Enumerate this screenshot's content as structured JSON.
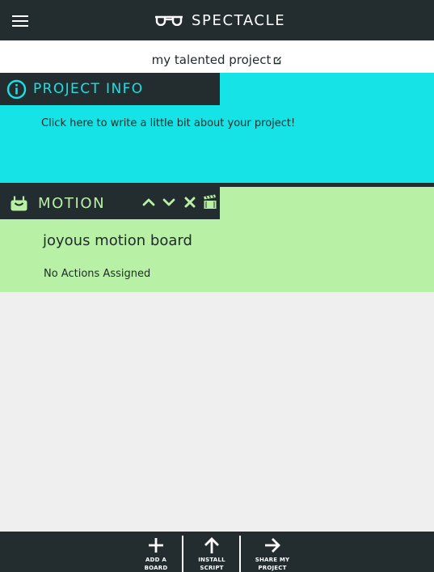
{
  "app": {
    "name": "SPECTACLE"
  },
  "header": {
    "menu_icon": "hamburger-menu-icon",
    "logo_icon": "glasses-icon"
  },
  "project": {
    "title": "my talented project",
    "edit_icon": "edit-pencil-icon"
  },
  "info_panel": {
    "tab_label": "PROJECT INFO",
    "icon": "info-circle-icon",
    "description": "Click here to write a little bit about your project!",
    "color": "#16e3e5"
  },
  "motion_panel": {
    "tab_label": "MOTION",
    "icon": "motion-board-icon",
    "board_name": "joyous motion board",
    "actions_status": "No Actions Assigned",
    "color": "#b8f1a5",
    "controls": [
      "chevron-up-icon",
      "chevron-down-icon",
      "close-icon",
      "clapperboard-icon"
    ]
  },
  "bottom_bar": {
    "add_board_label": "ADD A\nBOARD",
    "install_script_label": "INSTALL\nSCRIPT",
    "share_project_label": "SHARE MY\nPROJECT"
  },
  "colors": {
    "dark": "#232d2f",
    "background": "#efefef"
  }
}
